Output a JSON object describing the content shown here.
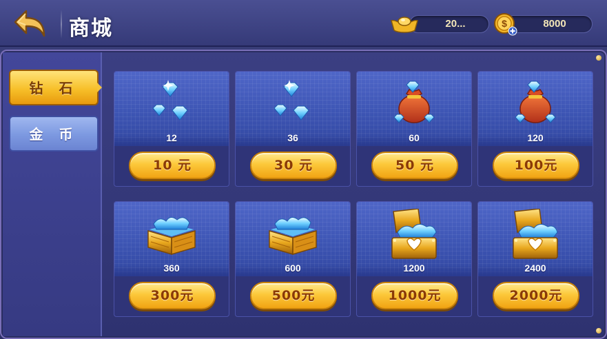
{
  "header": {
    "title": "商城",
    "gold_ingot_value": "20...",
    "coin_value": "8000"
  },
  "tabs": [
    {
      "label": "钻 石",
      "active": true
    },
    {
      "label": "金 币",
      "active": false
    }
  ],
  "products": [
    {
      "qty": "12",
      "price": "10 元",
      "icon": "diamond-cluster-icon"
    },
    {
      "qty": "36",
      "price": "30 元",
      "icon": "diamond-cluster-icon"
    },
    {
      "qty": "60",
      "price": "50 元",
      "icon": "diamond-bag-icon"
    },
    {
      "qty": "120",
      "price": "100元",
      "icon": "diamond-bag-icon"
    },
    {
      "qty": "360",
      "price": "300元",
      "icon": "diamond-crate-icon"
    },
    {
      "qty": "600",
      "price": "500元",
      "icon": "diamond-crate-icon"
    },
    {
      "qty": "1200",
      "price": "1000元",
      "icon": "diamond-chest-icon"
    },
    {
      "qty": "2400",
      "price": "2000元",
      "icon": "diamond-chest-icon"
    }
  ],
  "colors": {
    "accent_gold": "#f7c02a",
    "panel_blue": "#3b3f82"
  }
}
